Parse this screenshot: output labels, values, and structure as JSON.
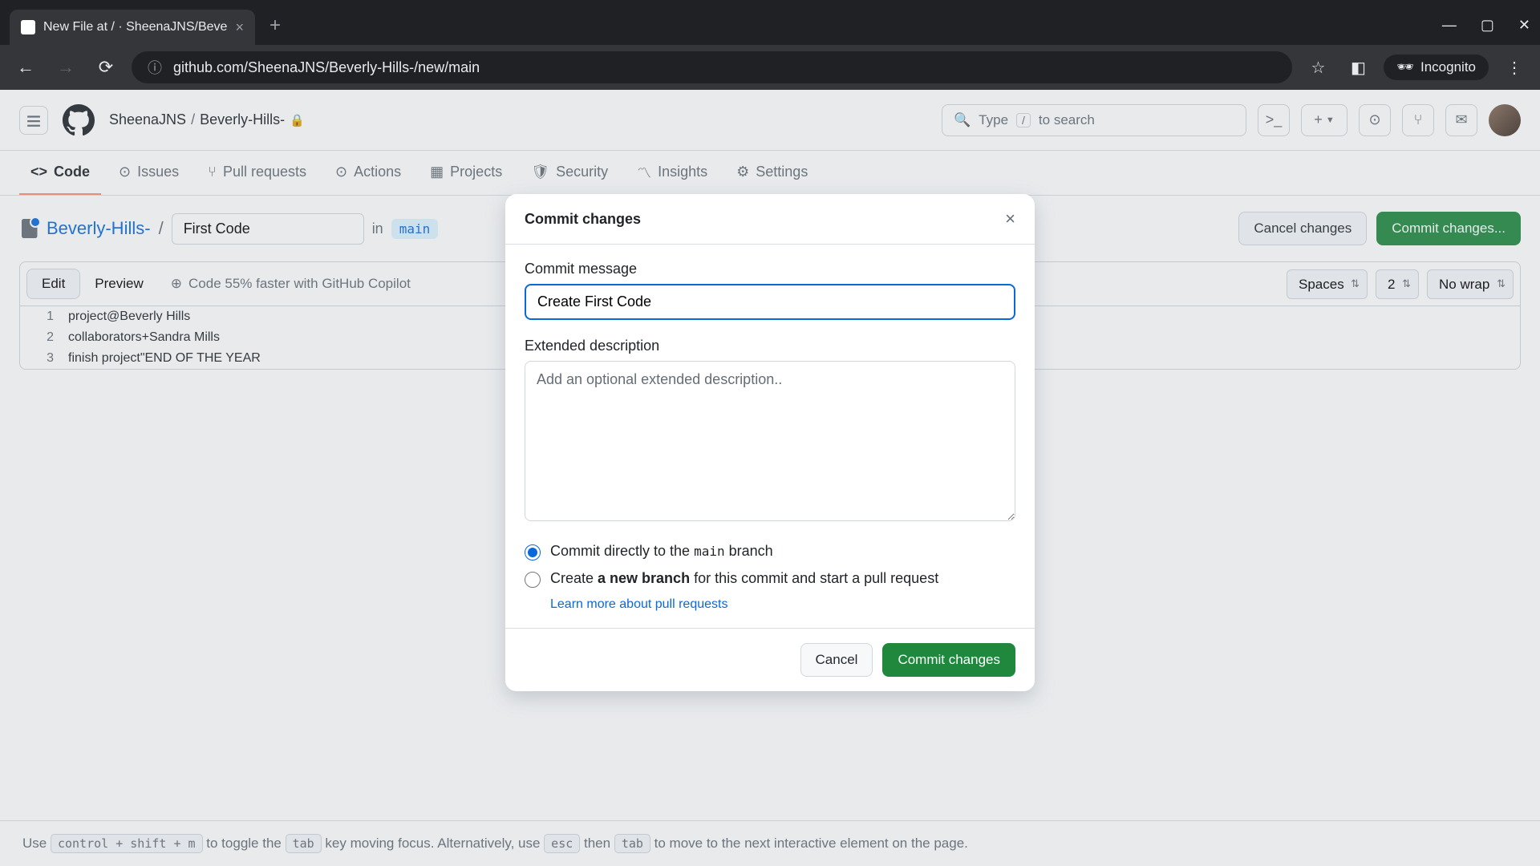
{
  "browser": {
    "tab_title": "New File at / · SheenaJNS/Beve",
    "url": "github.com/SheenaJNS/Beverly-Hills-/new/main",
    "incognito_label": "Incognito"
  },
  "header": {
    "owner": "SheenaJNS",
    "repo": "Beverly-Hills-",
    "search_placeholder": "Type",
    "search_hint": "to search",
    "search_key": "/"
  },
  "tabs": {
    "code": "Code",
    "issues": "Issues",
    "pulls": "Pull requests",
    "actions": "Actions",
    "projects": "Projects",
    "security": "Security",
    "insights": "Insights",
    "settings": "Settings"
  },
  "file": {
    "repo_link": "Beverly-Hills-",
    "name_value": "First Code",
    "in_label": "in",
    "branch": "main",
    "cancel_btn": "Cancel changes",
    "commit_btn": "Commit changes..."
  },
  "editor": {
    "edit_tab": "Edit",
    "preview_tab": "Preview",
    "copilot_hint": "Code 55% faster with GitHub Copilot",
    "indent": "Spaces",
    "indent_size": "2",
    "wrap": "No wrap",
    "lines": [
      "project@Beverly Hills",
      "collaborators+Sandra Mills",
      "finish project\"END OF THE YEAR"
    ]
  },
  "footer": {
    "t1": "Use ",
    "k1": "control + shift + m",
    "t2": " to toggle the ",
    "k2": "tab",
    "t3": " key moving focus. Alternatively, use ",
    "k3": "esc",
    "t4": " then ",
    "k4": "tab",
    "t5": " to move to the next interactive element on the page."
  },
  "modal": {
    "title": "Commit changes",
    "msg_label": "Commit message",
    "msg_value": "Create First Code",
    "desc_label": "Extended description",
    "desc_placeholder": "Add an optional extended description..",
    "radio1_a": "Commit directly to the ",
    "radio1_code": "main",
    "radio1_b": " branch",
    "radio2_a": "Create ",
    "radio2_strong": "a new branch",
    "radio2_b": " for this commit and start a pull request",
    "learn_link": "Learn more about pull requests",
    "cancel": "Cancel",
    "commit": "Commit changes"
  }
}
